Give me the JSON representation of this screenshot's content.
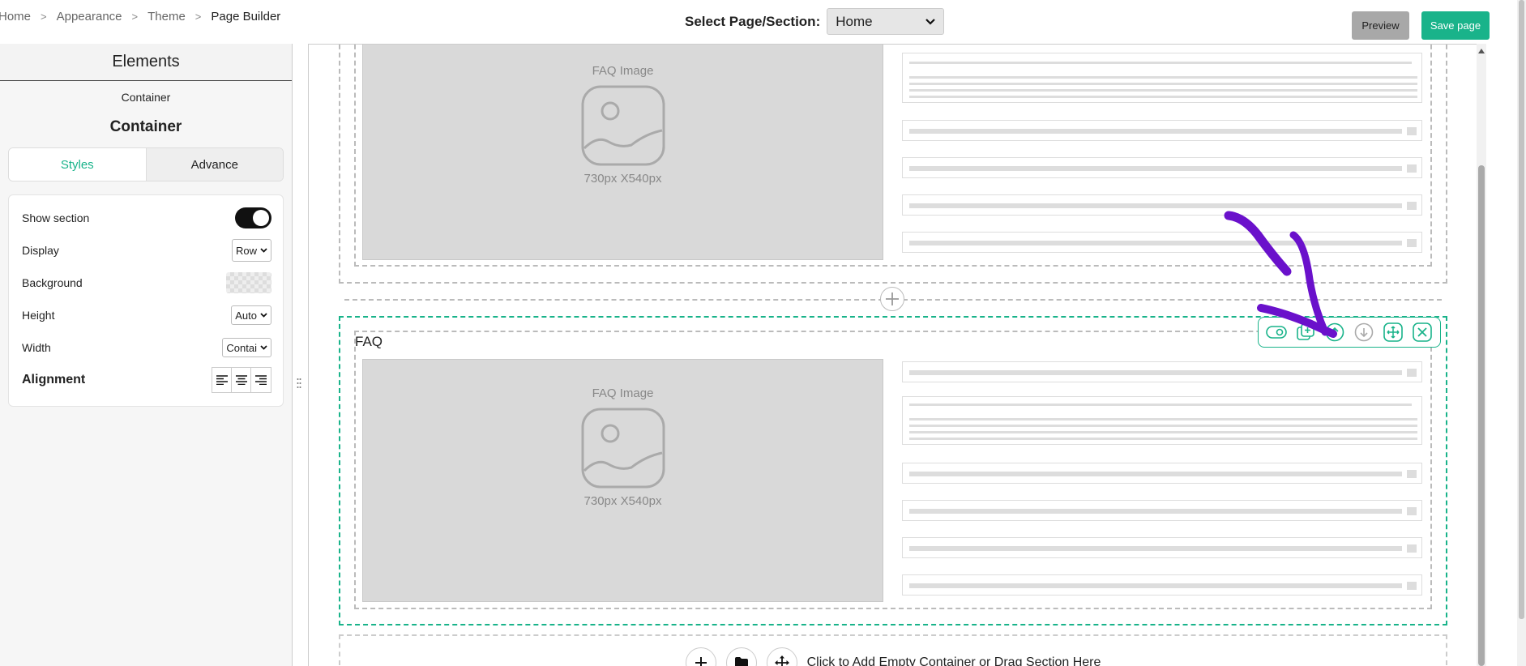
{
  "breadcrumbs": [
    "Home",
    "Appearance",
    "Theme",
    "Page Builder"
  ],
  "page_select": {
    "label": "Select Page/Section:",
    "value": "Home"
  },
  "buttons": {
    "preview": "Preview",
    "save": "Save page"
  },
  "sidebar": {
    "title": "Elements",
    "subtitle": "Container",
    "heading": "Container",
    "tabs": [
      {
        "label": "Styles",
        "active": true
      },
      {
        "label": "Advance",
        "active": false
      }
    ],
    "fields": {
      "show_section": "Show section",
      "display": "Display",
      "display_value": "Row",
      "background": "Background",
      "height": "Height",
      "height_value": "Auto",
      "width": "Width",
      "width_value": "Contai",
      "alignment": "Alignment"
    }
  },
  "canvas": {
    "image_caption": "FAQ Image",
    "image_size": "730px X540px",
    "faq_title": "FAQ",
    "add_bar_text": "Click to Add Empty Container or Drag Section Here"
  },
  "toolbar_icons": [
    "toggle-visibility-icon",
    "duplicate-icon",
    "move-up-icon",
    "move-down-icon",
    "drag-move-icon",
    "close-icon"
  ],
  "colors": {
    "accent": "#19b38a",
    "annotation": "#6a11cb",
    "preview_button": "#a8a8a8"
  }
}
